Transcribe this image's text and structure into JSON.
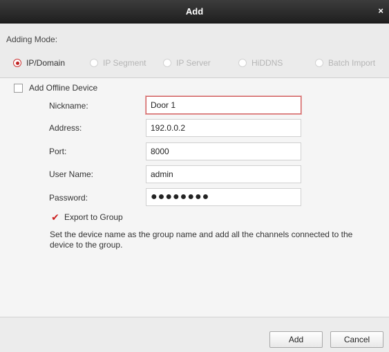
{
  "window": {
    "title": "Add",
    "close_glyph": "×"
  },
  "mode": {
    "label": "Adding Mode:",
    "options": [
      "IP/Domain",
      "IP Segment",
      "IP Server",
      "HiDDNS",
      "Batch Import"
    ],
    "selected": "IP/Domain"
  },
  "offline": {
    "label": "Add Offline Device",
    "checked": false
  },
  "form": {
    "nickname": {
      "label": "Nickname:",
      "value": "Door 1"
    },
    "address": {
      "label": "Address:",
      "value": "192.0.0.2"
    },
    "port": {
      "label": "Port:",
      "value": "8000"
    },
    "username": {
      "label": "User Name:",
      "value": "admin"
    },
    "password": {
      "label": "Password:",
      "value": "●●●●●●●●"
    }
  },
  "export": {
    "label": "Export to Group",
    "checked": true,
    "check_glyph": "✔",
    "description": "Set the device name as the group name and add all the channels connected to the device to the group."
  },
  "buttons": {
    "add": "Add",
    "cancel": "Cancel"
  },
  "colors": {
    "accent": "#c02222",
    "titlebar": "#2b2b2b"
  }
}
